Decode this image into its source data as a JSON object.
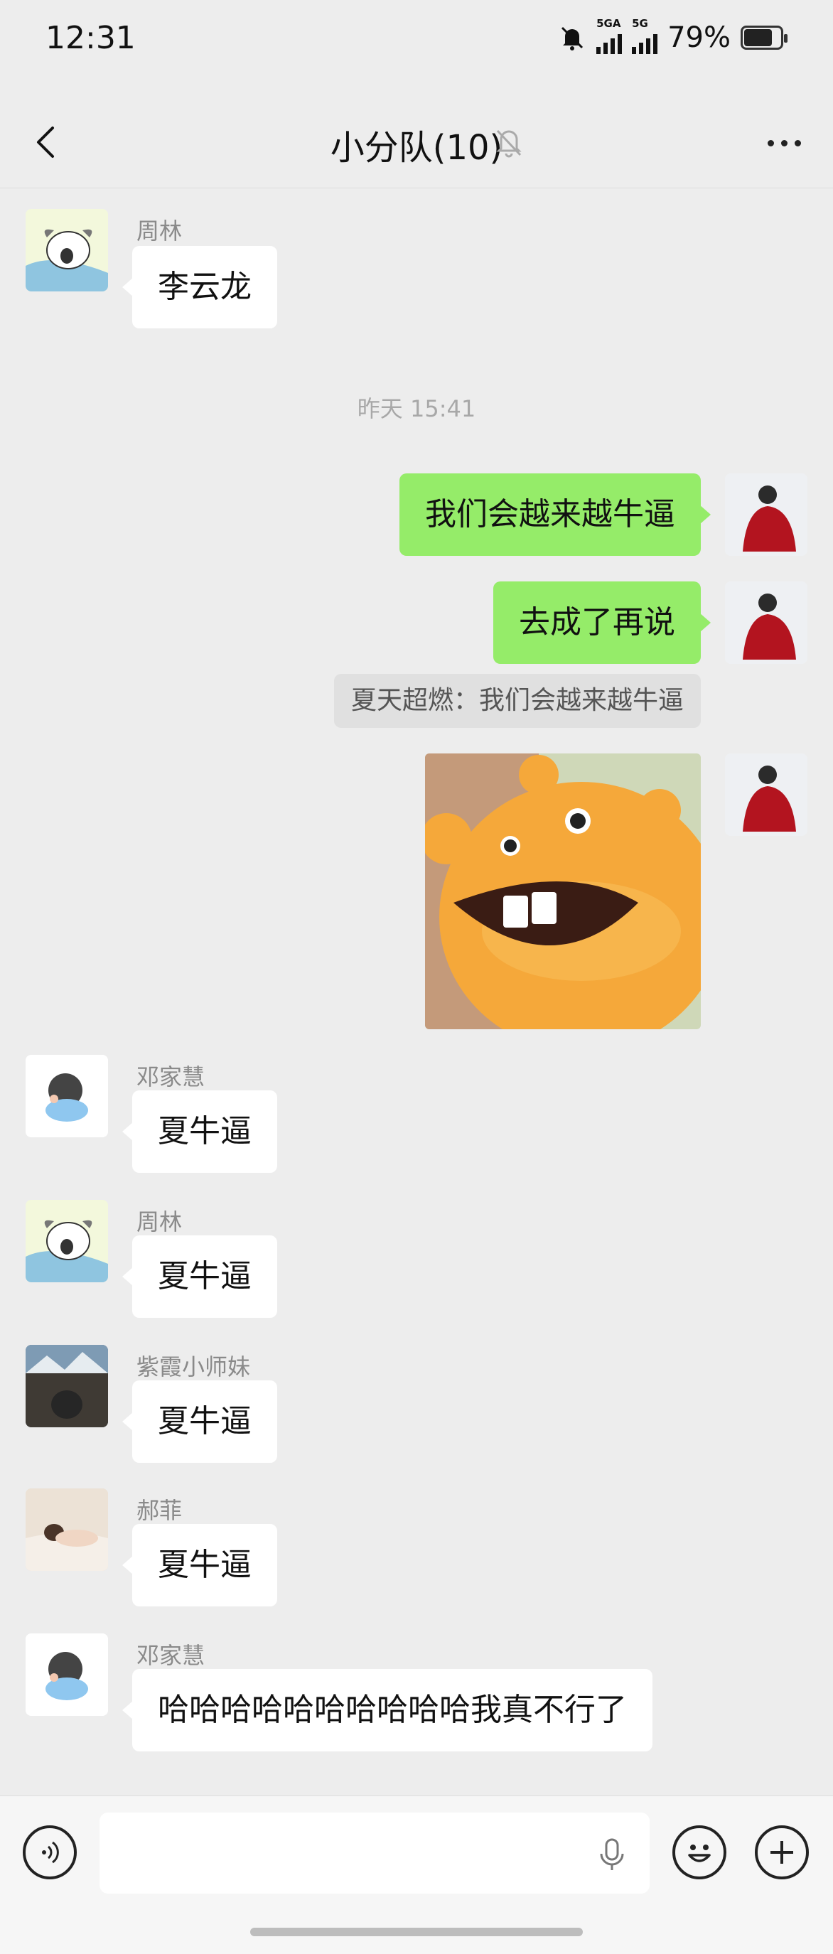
{
  "status": {
    "time": "12:31",
    "battery": "79%",
    "battery_level": 0.79,
    "sig1": "5GA",
    "sig2": "5G"
  },
  "header": {
    "title": "小分队(10)"
  },
  "messages": {
    "m1": {
      "sender": "周林",
      "text": "李云龙"
    },
    "timestamp": "昨天 15:41",
    "m2": {
      "text": "我们会越来越牛逼"
    },
    "m3": {
      "text": "去成了再说"
    },
    "quote": "夏天超燃：我们会越来越牛逼",
    "m5": {
      "sender": "邓家慧",
      "text": "夏牛逼"
    },
    "m6": {
      "sender": "周林",
      "text": "夏牛逼"
    },
    "m7": {
      "sender": "紫霞小师妹",
      "text": "夏牛逼"
    },
    "m8": {
      "sender": "郝菲",
      "text": "夏牛逼"
    },
    "m9": {
      "sender": "邓家慧",
      "text": "哈哈哈哈哈哈哈哈哈哈我真不行了"
    }
  },
  "icons": [
    "back-icon",
    "bell-muted-icon",
    "more-icon",
    "voice-icon",
    "microphone-icon",
    "emoji-icon",
    "plus-icon"
  ],
  "colors": {
    "bg": "#ededed",
    "self_bubble": "#95ec69",
    "other_bubble": "#ffffff",
    "sticker": "#f5a83a"
  }
}
